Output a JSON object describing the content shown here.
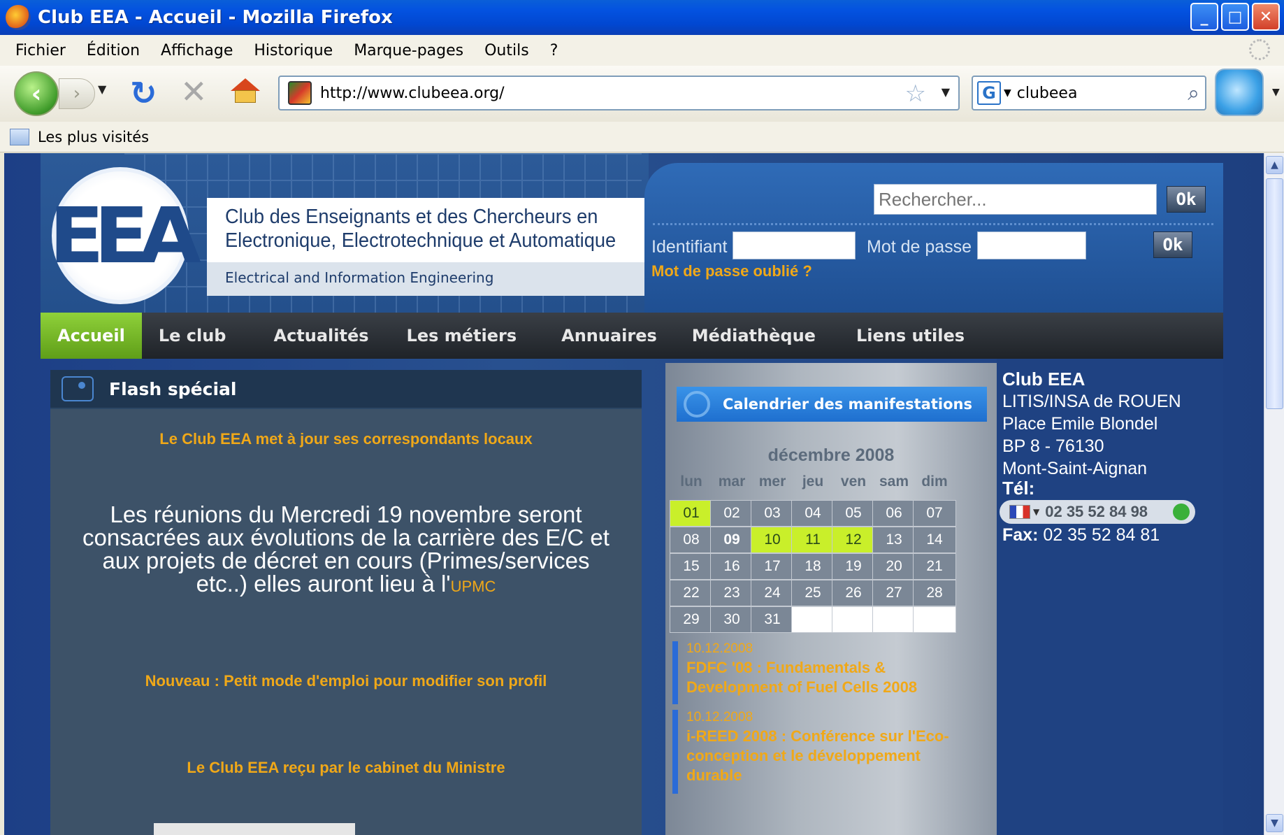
{
  "window": {
    "title": "Club EEA - Accueil - Mozilla Firefox",
    "controls": [
      "_",
      "□",
      "✕"
    ]
  },
  "menu": [
    "Fichier",
    "Édition",
    "Affichage",
    "Historique",
    "Marque-pages",
    "Outils",
    "?"
  ],
  "toolbar": {
    "url": "http://www.clubeea.org/",
    "search_engine": "G",
    "search_query": "clubeea"
  },
  "bookmarks": {
    "most_visited": "Les plus visités"
  },
  "header": {
    "logo_letters": "EEA",
    "club_name_line1": "Club des Enseignants et des Chercheurs en",
    "club_name_line2": "Electronique, Electrotechnique et Automatique",
    "club_subtitle": "Electrical and Information Engineering"
  },
  "login": {
    "search_placeholder": "Rechercher...",
    "ok_label": "Ok",
    "identifiant_label": "Identifiant",
    "password_label": "Mot de passe",
    "forgot_label": "Mot de passe oublié ?"
  },
  "nav": [
    "Accueil",
    "Le club",
    "Actualités",
    "Les métiers",
    "Annuaires",
    "Médiathèque",
    "Liens utiles"
  ],
  "flash": {
    "title": "Flash spécial",
    "link1": "Le Club EEA met à jour ses correspondants locaux",
    "message_line1": "Les réunions du Mercredi 19 novembre seront",
    "message_line2": "consacrées aux évolutions de la carrière des E/C et",
    "message_line3": "aux projets de décret en cours (Primes/services",
    "message_line4": "etc..) elles auront lieu à l'",
    "message_link": "UPMC",
    "link2": "Nouveau : Petit mode d'emploi pour modifier son profil",
    "link3": "Le Club EEA reçu par le cabinet du Ministre"
  },
  "calendar": {
    "heading": "Calendrier des manifestations",
    "month": "décembre 2008",
    "days_of_week": [
      "lun",
      "mar",
      "mer",
      "jeu",
      "ven",
      "sam",
      "dim"
    ],
    "weeks": [
      [
        "01",
        "02",
        "03",
        "04",
        "05",
        "06",
        "07"
      ],
      [
        "08",
        "09",
        "10",
        "11",
        "12",
        "13",
        "14"
      ],
      [
        "15",
        "16",
        "17",
        "18",
        "19",
        "20",
        "21"
      ],
      [
        "22",
        "23",
        "24",
        "25",
        "26",
        "27",
        "28"
      ],
      [
        "29",
        "30",
        "31",
        "",
        "",
        "",
        ""
      ]
    ],
    "highlighted_days": [
      "01",
      "10",
      "11",
      "12"
    ],
    "today": "09",
    "events": [
      {
        "date": "10.12.2008",
        "title_line1": "FDFC '08 : Fundamentals &",
        "title_line2": "Development of Fuel Cells 2008"
      },
      {
        "date": "10.12.2008",
        "title_line1": "i-REED 2008 : Conférence sur l'Eco-",
        "title_line2": "conception et le développement",
        "title_line3": "durable"
      }
    ]
  },
  "contact": {
    "name": "Club EEA",
    "address_line1": "LITIS/INSA de ROUEN",
    "address_line2": "Place Emile Blondel",
    "address_line3": "BP 8 - 76130",
    "address_line4": "Mont-Saint-Aignan",
    "tel_label": "Tél:",
    "tel": "02 35 52 84 98",
    "fax_label": "Fax:",
    "fax": "02 35 52 84 81"
  },
  "colors": {
    "accent_orange": "#f0a818",
    "nav_active_green": "#7fbf2a",
    "calendar_highlight": "#c9ef2a",
    "page_blue": "#1f4282"
  }
}
